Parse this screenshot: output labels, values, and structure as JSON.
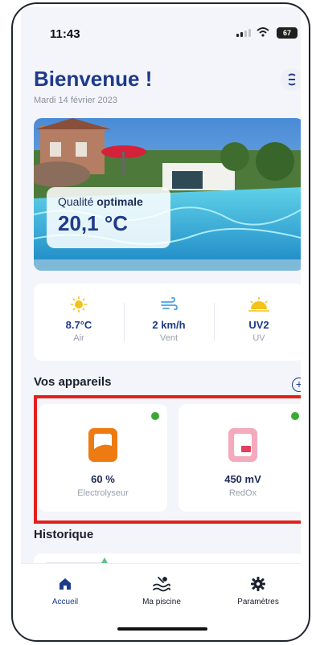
{
  "status_bar": {
    "time": "11:43",
    "battery": "67"
  },
  "header": {
    "title": "Bienvenue !",
    "date": "Mardi 14 février 2023"
  },
  "hero": {
    "quality_prefix": "Qualité",
    "quality_value": "optimale",
    "temperature": "20,1 °C"
  },
  "weather": [
    {
      "icon": "sun-icon",
      "value": "8.7°C",
      "label": "Air"
    },
    {
      "icon": "wind-icon",
      "value": "2 km/h",
      "label": "Vent"
    },
    {
      "icon": "uv-icon",
      "value": "UV2",
      "label": "UV"
    }
  ],
  "devices": {
    "title": "Vos appareils",
    "items": [
      {
        "icon": "electrolyser-icon",
        "value": "60 %",
        "label": "Electrolyseur",
        "status_color": "#3aaa35"
      },
      {
        "icon": "redox-icon",
        "value": "450 mV",
        "label": "RedOx",
        "status_color": "#3aaa35"
      }
    ]
  },
  "history": {
    "title": "Historique"
  },
  "tabs": [
    {
      "icon": "home-icon",
      "label": "Accueil"
    },
    {
      "icon": "pool-icon",
      "label": "Ma piscine"
    },
    {
      "icon": "gear-icon",
      "label": "Paramètres"
    }
  ],
  "colors": {
    "primary": "#1e3a8a",
    "status_ok": "#3aaa35",
    "highlight": "#e3211c"
  }
}
